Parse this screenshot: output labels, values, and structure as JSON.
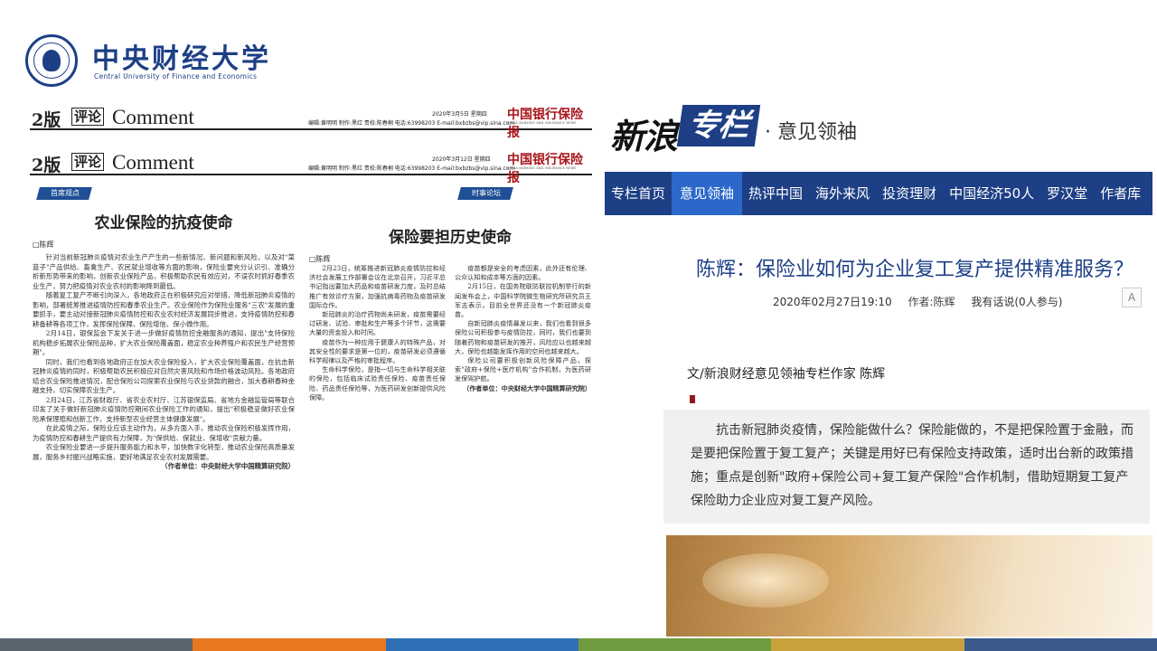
{
  "university": {
    "name_cn": "中央财经大学",
    "name_en": "Central University of Finance and Economics"
  },
  "newspaper_headers": [
    {
      "version": "2版",
      "section_cn": "评论",
      "section_en": "Comment",
      "date": "2020年3月5日 星期四",
      "meta": "编辑:黄明明 制作:黑红 责校:陈春桐 电话:63998203 E-mail:bxbzbs@vip.sina.com",
      "masthead": "中国银行保险报",
      "masthead_en": "CHINA BANKING AND INSURANCE NEWS"
    },
    {
      "version": "2版",
      "section_cn": "评论",
      "section_en": "Comment",
      "date": "2020年3月12日 星期四",
      "meta": "编辑:黄明明 制作:黑红 责校:陈春桐 电话:63998203 E-mail:bxbzbs@vip.sina.com",
      "masthead": "中国银行保险报",
      "masthead_en": "CHINA BANKING AND INSURANCE NEWS"
    }
  ],
  "column_tags": {
    "left": "首席观点",
    "right": "时事论坛"
  },
  "article_left": {
    "title": "农业保险的抗疫使命",
    "byline": "□陈辉",
    "paragraphs": [
      "针对当前新冠肺炎疫情对农业生产产生的一些新情况、新问题和新风险，以及对\"菜篮子\"产品供给、畜禽生产、农民就业增收等方面的影响，保险业要充分认识引、准确分析新形势带来的影响，创新农业保险产品，积极帮助农民有效应对，不误农时抓好春季农业生产，努力把疫情对农业农村的影响降到最低。",
      "随着复工复产不断引向深入，各地政府正在积极研究应对举措，降低新冠肺炎疫情的影响，部署统筹推进疫情防控和春季农业生产。农业保险作为保险业服务\"三农\"发展的重要抓手，要主动对接新冠肺炎疫情防控和农业农村经济发展同步推进，支持疫情防控和春耕备耕等各项工作，发挥保险保障、保险增信、保小微作用。",
      "2月14日，银保监会下发关于进一步做好疫情防控金融服务的通知，提出\"支持保险机构稳步拓展农业保险品种，扩大农业保险覆盖面，稳定农业种养殖户和农民生产经营预期\"。",
      "同时，我们也看到各地政府正在加大农业保险投入，扩大农业保险覆盖面，在抗击新冠肺炎疫情的同时，积极帮助农民积极应对自然灾害风险和市场价格波动风险。各地政府结合农业保险推进情况，配合保险公司探索农业保险与农业贷款的融合，加大春耕春种金融支持，切实保障农业生产。",
      "2月24日，江苏省财政厅、省农业农村厅、江苏银保监局、省地方金融监管局等联合印发了关于做好新冠肺炎疫情防控期间农业保险工作的通知，提出\"积极稳妥做好农业保险承保理赔和创新工作，支持新型农业经营主体健康发展\"。",
      "在此疫情之际，保险业应该主动作为，从多方面入手，推动农业保险积极发挥作用，为疫情防控和春耕生产提供有力保障，为\"保供给、保就业、保增收\"贡献力量。",
      "农业保险业要进一步提升服务能力和水平，加快数字化转型，推动农业保险高质量发展，服务乡村振兴战略实施，更好地满足农业农村发展需要。"
    ],
    "unit": "（作者单位：中央财经大学中国精算研究院）"
  },
  "article_right": {
    "title": "保险要担历史使命",
    "byline": "□陈辉",
    "col1": [
      "2月23日，统筹推进新冠肺炎疫情防控和经济社会发展工作部署会议在北京召开，习近平总书记指出要加大药品和疫苗研发力度，及时总结推广有效诊疗方案，加强抗病毒药物及疫苗研发国际合作。",
      "新冠肺炎的治疗药物尚未研发，疫苗需要经过研发、试验、审批和生产等多个环节，这需要大量的资金投入和时间。",
      "疫苗作为一种应用于健康人的特殊产品，对其安全性的要求是第一位的，疫苗研发必须遵循科学规律以及严格的审批程序。",
      "生命科学保险，是指一切与生命科学相关联的保险，包括临床试验责任保险、疫苗责任保险、药品责任保险等，为医药研发创新提供风险保障。"
    ],
    "col2": [
      "疫苗都是安全的考虑因素，此外还有伦理、公众认知和成本等方面的因素。",
      "2月15日，在国务院联防联控机制举行的新闻发布会上，中国科学院微生物研究所研究员王军志表示，目前全世界还没有一个新冠肺炎疫苗。",
      "自新冠肺炎疫情暴发以来，我们也看到很多保险公司积极参与疫情防控，同时，我们也要到随着药物和疫苗研发的推开，风险应以也越来越大，保险也越能发挥作用的空间也越来越大。",
      "保险公司要积极创新风险保障产品，探索\"政府+保险+医疗机构\"合作机制，为医药研发保驾护航。"
    ],
    "unit": "（作者单位：中央财经大学中国精算研究院）"
  },
  "sina": {
    "logo": "新浪",
    "column": "专栏",
    "subtitle": "· 意见领袖",
    "nav": [
      {
        "label": "专栏首页",
        "active": false
      },
      {
        "label": "意见领袖",
        "active": true
      },
      {
        "label": "热评中国",
        "active": false
      },
      {
        "label": "海外来风",
        "active": false
      },
      {
        "label": "投资理财",
        "active": false
      },
      {
        "label": "中国经济50人",
        "active": false
      },
      {
        "label": "罗汉堂",
        "active": false
      },
      {
        "label": "作者库",
        "active": false
      }
    ],
    "article": {
      "title": "陈辉：保险业如何为企业复工复产提供精准服务？",
      "datetime": "2020年02月27日19:10",
      "author": "作者:陈辉",
      "comment": "我有话说(0人参与)",
      "font_icon": "A",
      "byline": "文/新浪财经意见领袖专栏作家 陈辉",
      "summary": "抗击新冠肺炎疫情，保险能做什么？保险能做的，不是把保险置于金融，而是要把保险置于复工复产；关键是用好已有保险支持政策，适时出台新的政策措施；重点是创新\"政府+保险公司+复工复产保险\"合作机制，借助短期复工复产保险助力企业应对复工复产风险。"
    }
  },
  "bottom_band_colors": [
    "#5a6570",
    "#e8781f",
    "#2f6fb5",
    "#6f9b3e",
    "#c9a13b",
    "#3a5a8c"
  ]
}
